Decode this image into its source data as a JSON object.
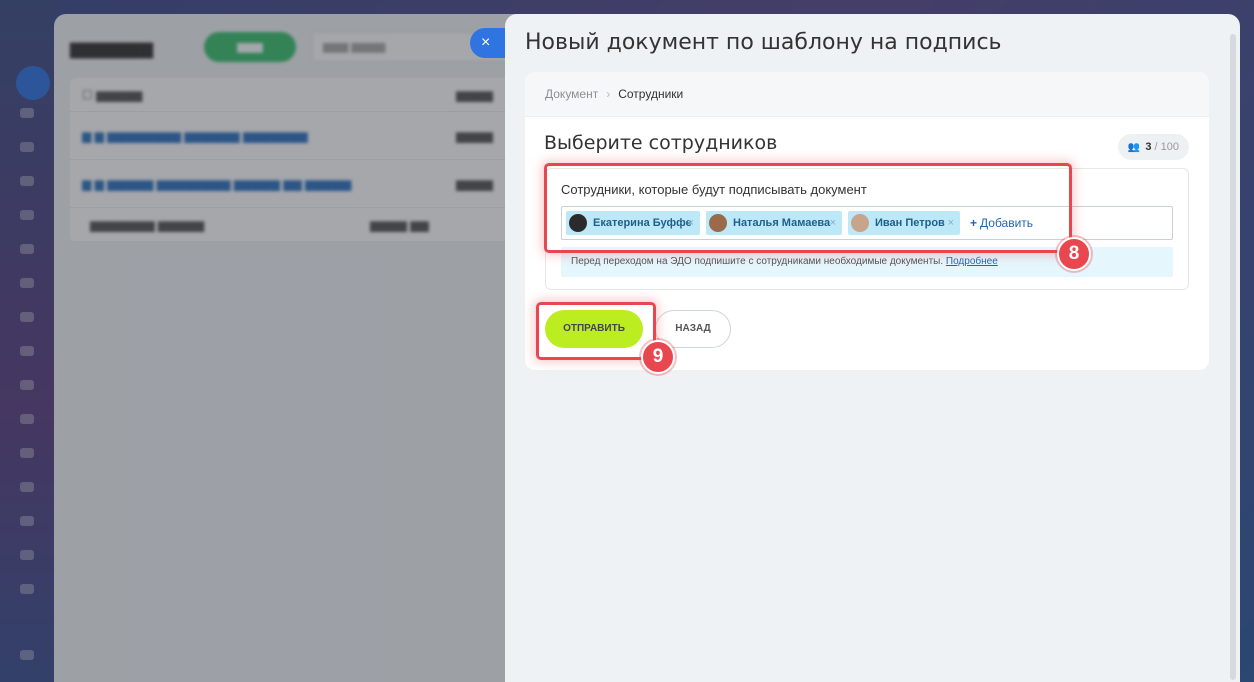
{
  "slider": {
    "title": "Новый документ по шаблону на подпись",
    "close_icon": "×"
  },
  "breadcrumb": {
    "items": [
      "Документ",
      "Сотрудники"
    ]
  },
  "section": {
    "title": "Выберите сотрудников",
    "counter": {
      "selected": "3",
      "max": "100"
    }
  },
  "employees_field": {
    "label": "Сотрудники, которые будут подписывать документ",
    "tags": [
      {
        "name": "Екатерина Буффе",
        "avatar_color": "#2b2b2b"
      },
      {
        "name": "Наталья Мамаева",
        "avatar_color": "#9a6a4a"
      },
      {
        "name": "Иван Петров",
        "avatar_color": "#c7a58a"
      }
    ],
    "add_label": "Добавить"
  },
  "info_note": {
    "text": "Перед переходом на ЭДО подпишите с сотрудниками необходимые документы.",
    "link": "Подробнее"
  },
  "buttons": {
    "send": "ОТПРАВИТЬ",
    "back": "НАЗАД"
  },
  "annotations": {
    "step_8": "8",
    "step_9": "9",
    "highlight_color": "#e8474f"
  },
  "colors": {
    "send_button": "#bbed21",
    "tag_bg": "#bde8f7",
    "close_button": "#2f74e0"
  }
}
